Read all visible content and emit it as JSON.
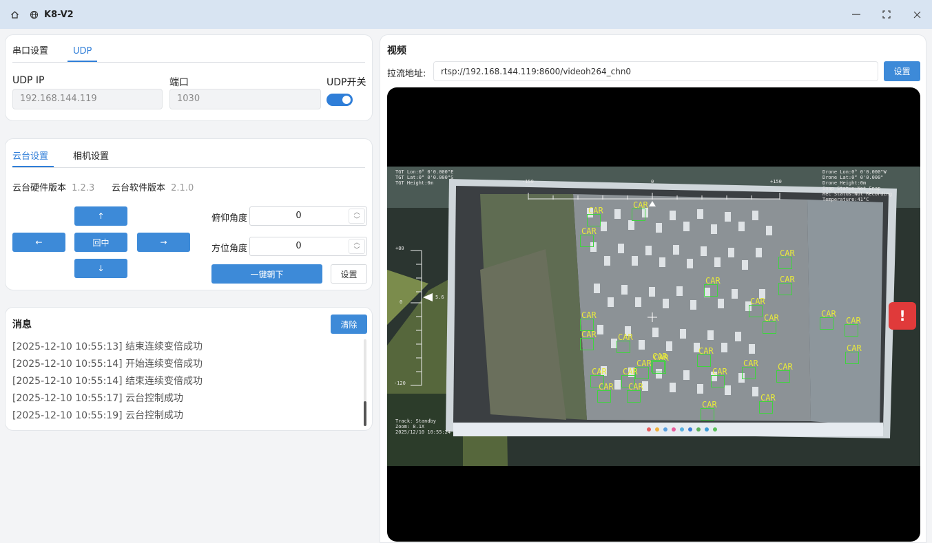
{
  "window": {
    "title": "K8-V2"
  },
  "conn": {
    "tabs": [
      "串口设置",
      "UDP"
    ],
    "ip_label": "UDP IP",
    "ip_value": "192.168.144.119",
    "port_label": "端口",
    "port_value": "1030",
    "switch_label": "UDP开关",
    "switch_on": true
  },
  "gimbal": {
    "tabs": [
      "云台设置",
      "相机设置"
    ],
    "hw_label": "云台硬件版本",
    "hw_value": "1.2.3",
    "sw_label": "云台软件版本",
    "sw_value": "2.1.0",
    "up": "↑",
    "left": "←",
    "center": "回中",
    "right": "→",
    "down": "↓",
    "pitch_label": "俯仰角度",
    "pitch_value": "0",
    "yaw_label": "方位角度",
    "yaw_value": "0",
    "down_one_key": "一键朝下",
    "set": "设置"
  },
  "messages": {
    "title": "消息",
    "clear": "清除",
    "lines": [
      "[2025-12-10 10:55:13] 结束连续变倍成功",
      "[2025-12-10 10:55:14] 开始连续变倍成功",
      "[2025-12-10 10:55:14] 结束连续变倍成功",
      "[2025-12-10 10:55:17] 云台控制成功",
      "[2025-12-10 10:55:19] 云台控制成功"
    ]
  },
  "video": {
    "title": "视频",
    "url_label": "拉流地址:",
    "url_value": "rtsp://192.168.144.119:8600/videoh264_chn0",
    "set": "设置",
    "osd": {
      "top_left": "TGT Lon:0° 0'0.000\"E\nTGT Lat:0° 0'0.000\"S\nTGT Height:0m",
      "top_right": "Drone Lon:0° 0'0.000\"W\nDrone Lat:0° 0'0.000\"\nDrone Height:0m\nSnap Status:Not Snap\nRec Status:Not Recording\nTemperature:41°C",
      "bottom_left": "Track: Standby\nZoom: 8.1X\n2025/12/10 10:55:24",
      "scale_left": "-150",
      "scale_mid": "0",
      "scale_right": "+150",
      "v_top": "+80",
      "v_zero": "0",
      "v_bottom": "-120",
      "v_marker": "5.6"
    },
    "detection_label": "CAR",
    "alert_icon": "!"
  }
}
